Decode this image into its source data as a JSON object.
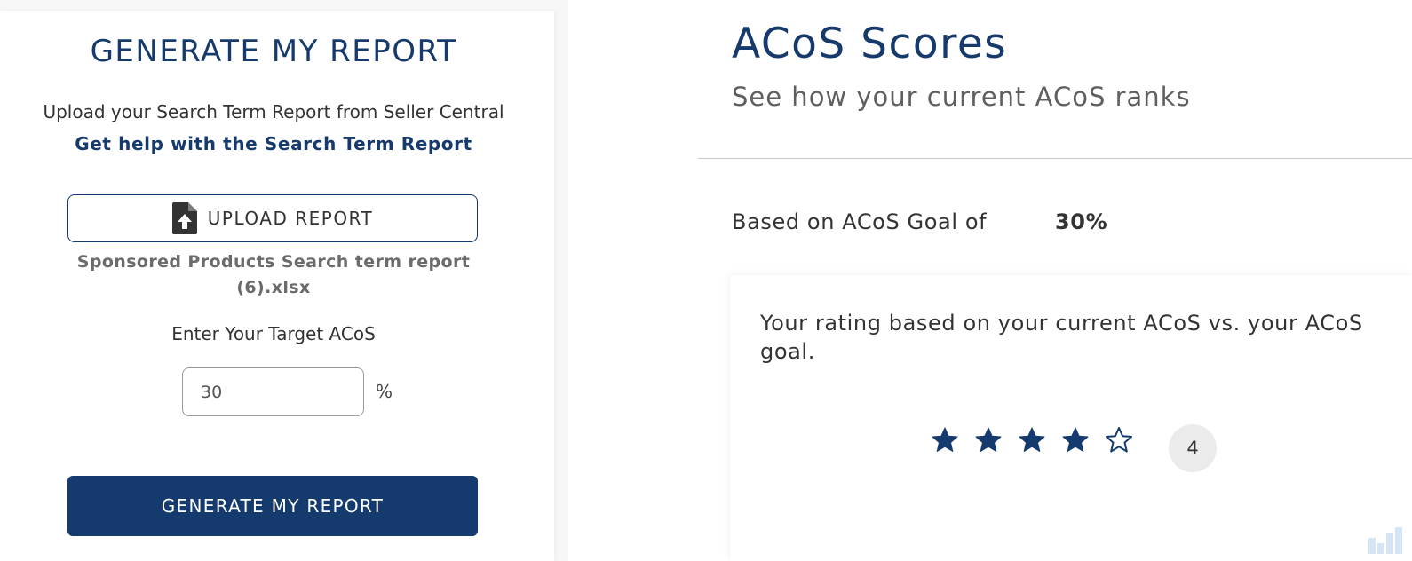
{
  "left_panel": {
    "title": "GENERATE MY REPORT",
    "upload_instruction": "Upload your Search Term Report from Seller Central",
    "help_link": "Get help with the Search Term Report",
    "upload_button": {
      "label": "UPLOAD REPORT",
      "icon": "file-upload-icon"
    },
    "file_name": "Sponsored Products Search term report (6).xlsx",
    "target_label": "Enter Your Target ACoS",
    "target_input": {
      "value": "30",
      "unit": "%"
    },
    "generate_button": "GENERATE MY REPORT"
  },
  "right_panel": {
    "title": "ACoS Scores",
    "subtitle": "See how your current ACoS ranks",
    "goal_label": "Based on ACoS Goal of",
    "goal_value": "30%",
    "rating_card": {
      "text": "Your rating based on your current ACoS vs. your ACoS goal.",
      "rating": 4,
      "max_rating": 5,
      "rating_display": "4"
    }
  },
  "colors": {
    "brand_navy": "#143a6e",
    "title_navy": "#163a6b",
    "badge_bg": "#ebebeb"
  }
}
